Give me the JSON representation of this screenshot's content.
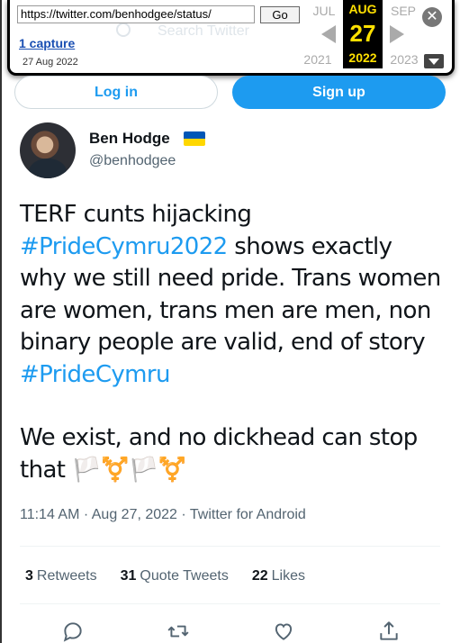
{
  "wayback": {
    "url": "https://twitter.com/benhodgee/status/",
    "go_label": "Go",
    "captures": "1 capture",
    "capture_date": "27 Aug 2022",
    "ghost_search": "Search Twitter",
    "prev_month": "JUL",
    "cur_month": "AUG",
    "next_month": "SEP",
    "cur_day": "27",
    "prev_year": "2021",
    "cur_year": "2022",
    "next_year": "2023"
  },
  "auth": {
    "login_label": "Log in",
    "signup_label": "Sign up"
  },
  "author": {
    "name": "Ben Hodge",
    "handle": "@benhodgee",
    "flag_icon": "ukraine-flag-icon"
  },
  "tweet": {
    "p1_a": "TERF cunts hijacking ",
    "p1_tag": "#PrideCymru2022",
    "p1_b": " shows exactly why we still need pride. Trans women are women, trans men are men, non binary people are valid, end of story ",
    "p1_tag2": "#PrideCymru",
    "p2": "We exist, and no dickhead can stop that 🏳️⚧️🏳️⚧️"
  },
  "meta": "11:14 AM · Aug 27, 2022 · Twitter for Android",
  "stats": {
    "retweets_count": "3",
    "retweets_label": "Retweets",
    "quotes_count": "31",
    "quotes_label": "Quote Tweets",
    "likes_count": "22",
    "likes_label": "Likes"
  },
  "colors": {
    "accent": "#1d9bf0",
    "wayback_highlight": "#ffe000"
  }
}
